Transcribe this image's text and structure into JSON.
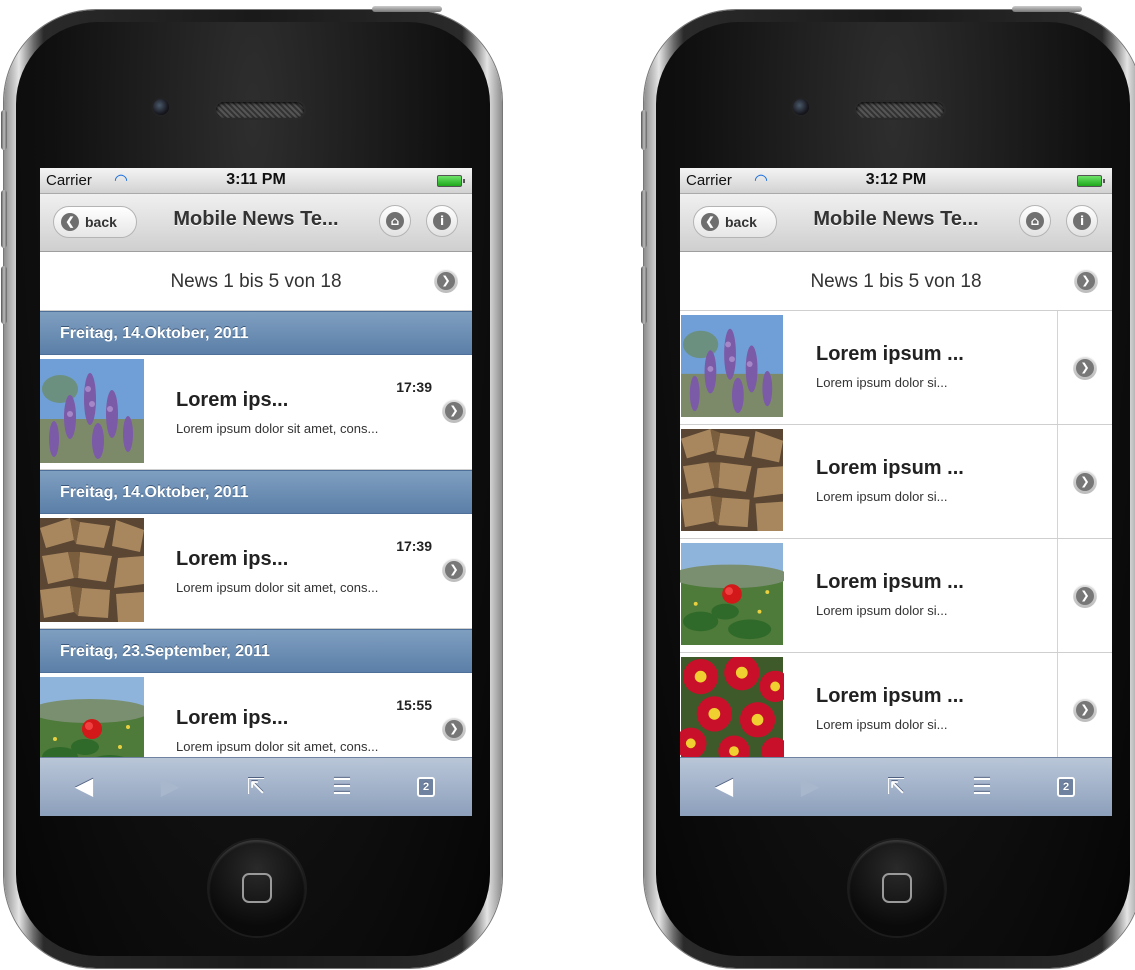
{
  "colors": {
    "list_divider": "#6a8db5",
    "toolbar": "#a3b3ca",
    "header": "#dcdcdc",
    "battery": "#3bc437",
    "wifi": "#1a6ee0"
  },
  "icons": {
    "back": "chevron-left-icon",
    "home": "home-icon",
    "info": "info-icon",
    "next": "chevron-right-icon",
    "wifi": "wifi-icon",
    "battery": "battery-icon",
    "browser_back": "arrow-left-icon",
    "browser_forward": "arrow-right-icon",
    "share": "share-icon",
    "bookmarks": "bookmarks-icon",
    "tabs": "tabs-icon"
  },
  "left": {
    "status": {
      "carrier": "Carrier",
      "time": "3:11 PM"
    },
    "header": {
      "back_label": "back",
      "title": "Mobile News Te..."
    },
    "pager": {
      "text": "News 1 bis 5 von 18"
    },
    "groups": [
      {
        "date": "Freitag, 14.Oktober, 2011",
        "item": {
          "title": "Lorem ips...",
          "desc": "Lorem ipsum dolor sit amet, cons...",
          "time": "17:39",
          "image": "lavender"
        }
      },
      {
        "date": "Freitag, 14.Oktober, 2011",
        "item": {
          "title": "Lorem ips...",
          "desc": "Lorem ipsum dolor sit amet, cons...",
          "time": "17:39",
          "image": "woodpile"
        }
      },
      {
        "date": "Freitag, 23.September, 2011",
        "item": {
          "title": "Lorem ips...",
          "desc": "Lorem ipsum dolor sit amet, cons...",
          "time": "15:55",
          "image": "red-flower"
        }
      }
    ],
    "toolbar": {
      "tabs_count": "2"
    }
  },
  "right": {
    "status": {
      "carrier": "Carrier",
      "time": "3:12 PM"
    },
    "header": {
      "back_label": "back",
      "title": "Mobile News Te..."
    },
    "pager": {
      "text": "News 1 bis 5 von 18"
    },
    "items": [
      {
        "title": "Lorem ipsum ...",
        "desc": "Lorem ipsum dolor si...",
        "image": "lavender"
      },
      {
        "title": "Lorem ipsum ...",
        "desc": "Lorem ipsum dolor si...",
        "image": "woodpile"
      },
      {
        "title": "Lorem ipsum ...",
        "desc": "Lorem ipsum dolor si...",
        "image": "red-flower"
      },
      {
        "title": "Lorem ipsum ...",
        "desc": "Lorem ipsum dolor si...",
        "image": "primulas"
      }
    ],
    "toolbar": {
      "tabs_count": "2"
    }
  }
}
